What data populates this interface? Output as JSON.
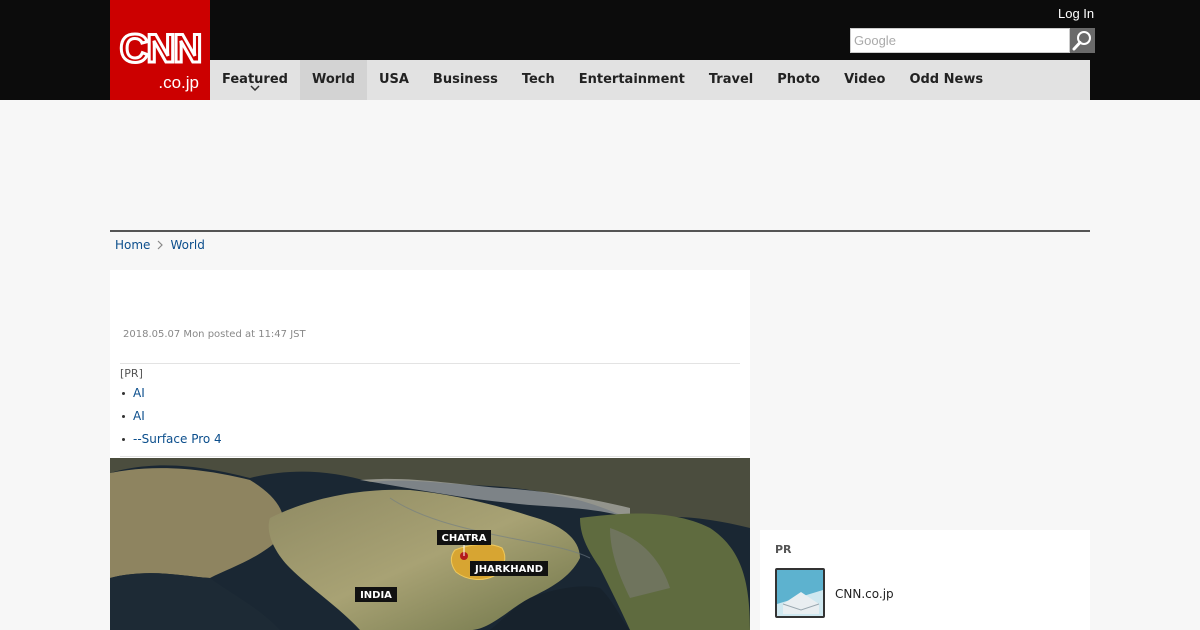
{
  "header": {
    "logo_main": "CNN",
    "logo_sub": ".co.jp",
    "login_label": "Log In",
    "search_placeholder": "Google"
  },
  "nav": {
    "items": [
      {
        "label": "Featured"
      },
      {
        "label": "World"
      },
      {
        "label": "USA"
      },
      {
        "label": "Business"
      },
      {
        "label": "Tech"
      },
      {
        "label": "Entertainment"
      },
      {
        "label": "Travel"
      },
      {
        "label": "Photo"
      },
      {
        "label": "Video"
      },
      {
        "label": "Odd News"
      }
    ]
  },
  "breadcrumb": {
    "home": "Home",
    "current": "World"
  },
  "article": {
    "date": "2018.05.07 Mon posted at 11:47 JST",
    "pr_tag": "[PR]",
    "pr_links": [
      "AI",
      "AI",
      "--Surface Pro 4"
    ],
    "map_labels": {
      "chatra": "CHATRA",
      "jharkhand": "JHARKHAND",
      "india": "INDIA"
    }
  },
  "sidebar": {
    "pr_title": "PR",
    "pr_item_label": "CNN.co.jp"
  },
  "colors": {
    "brand_red": "#cc0000",
    "header_bg": "#0c0c0c",
    "nav_bg": "#e2e2e2",
    "link": "#0b4e8c"
  }
}
